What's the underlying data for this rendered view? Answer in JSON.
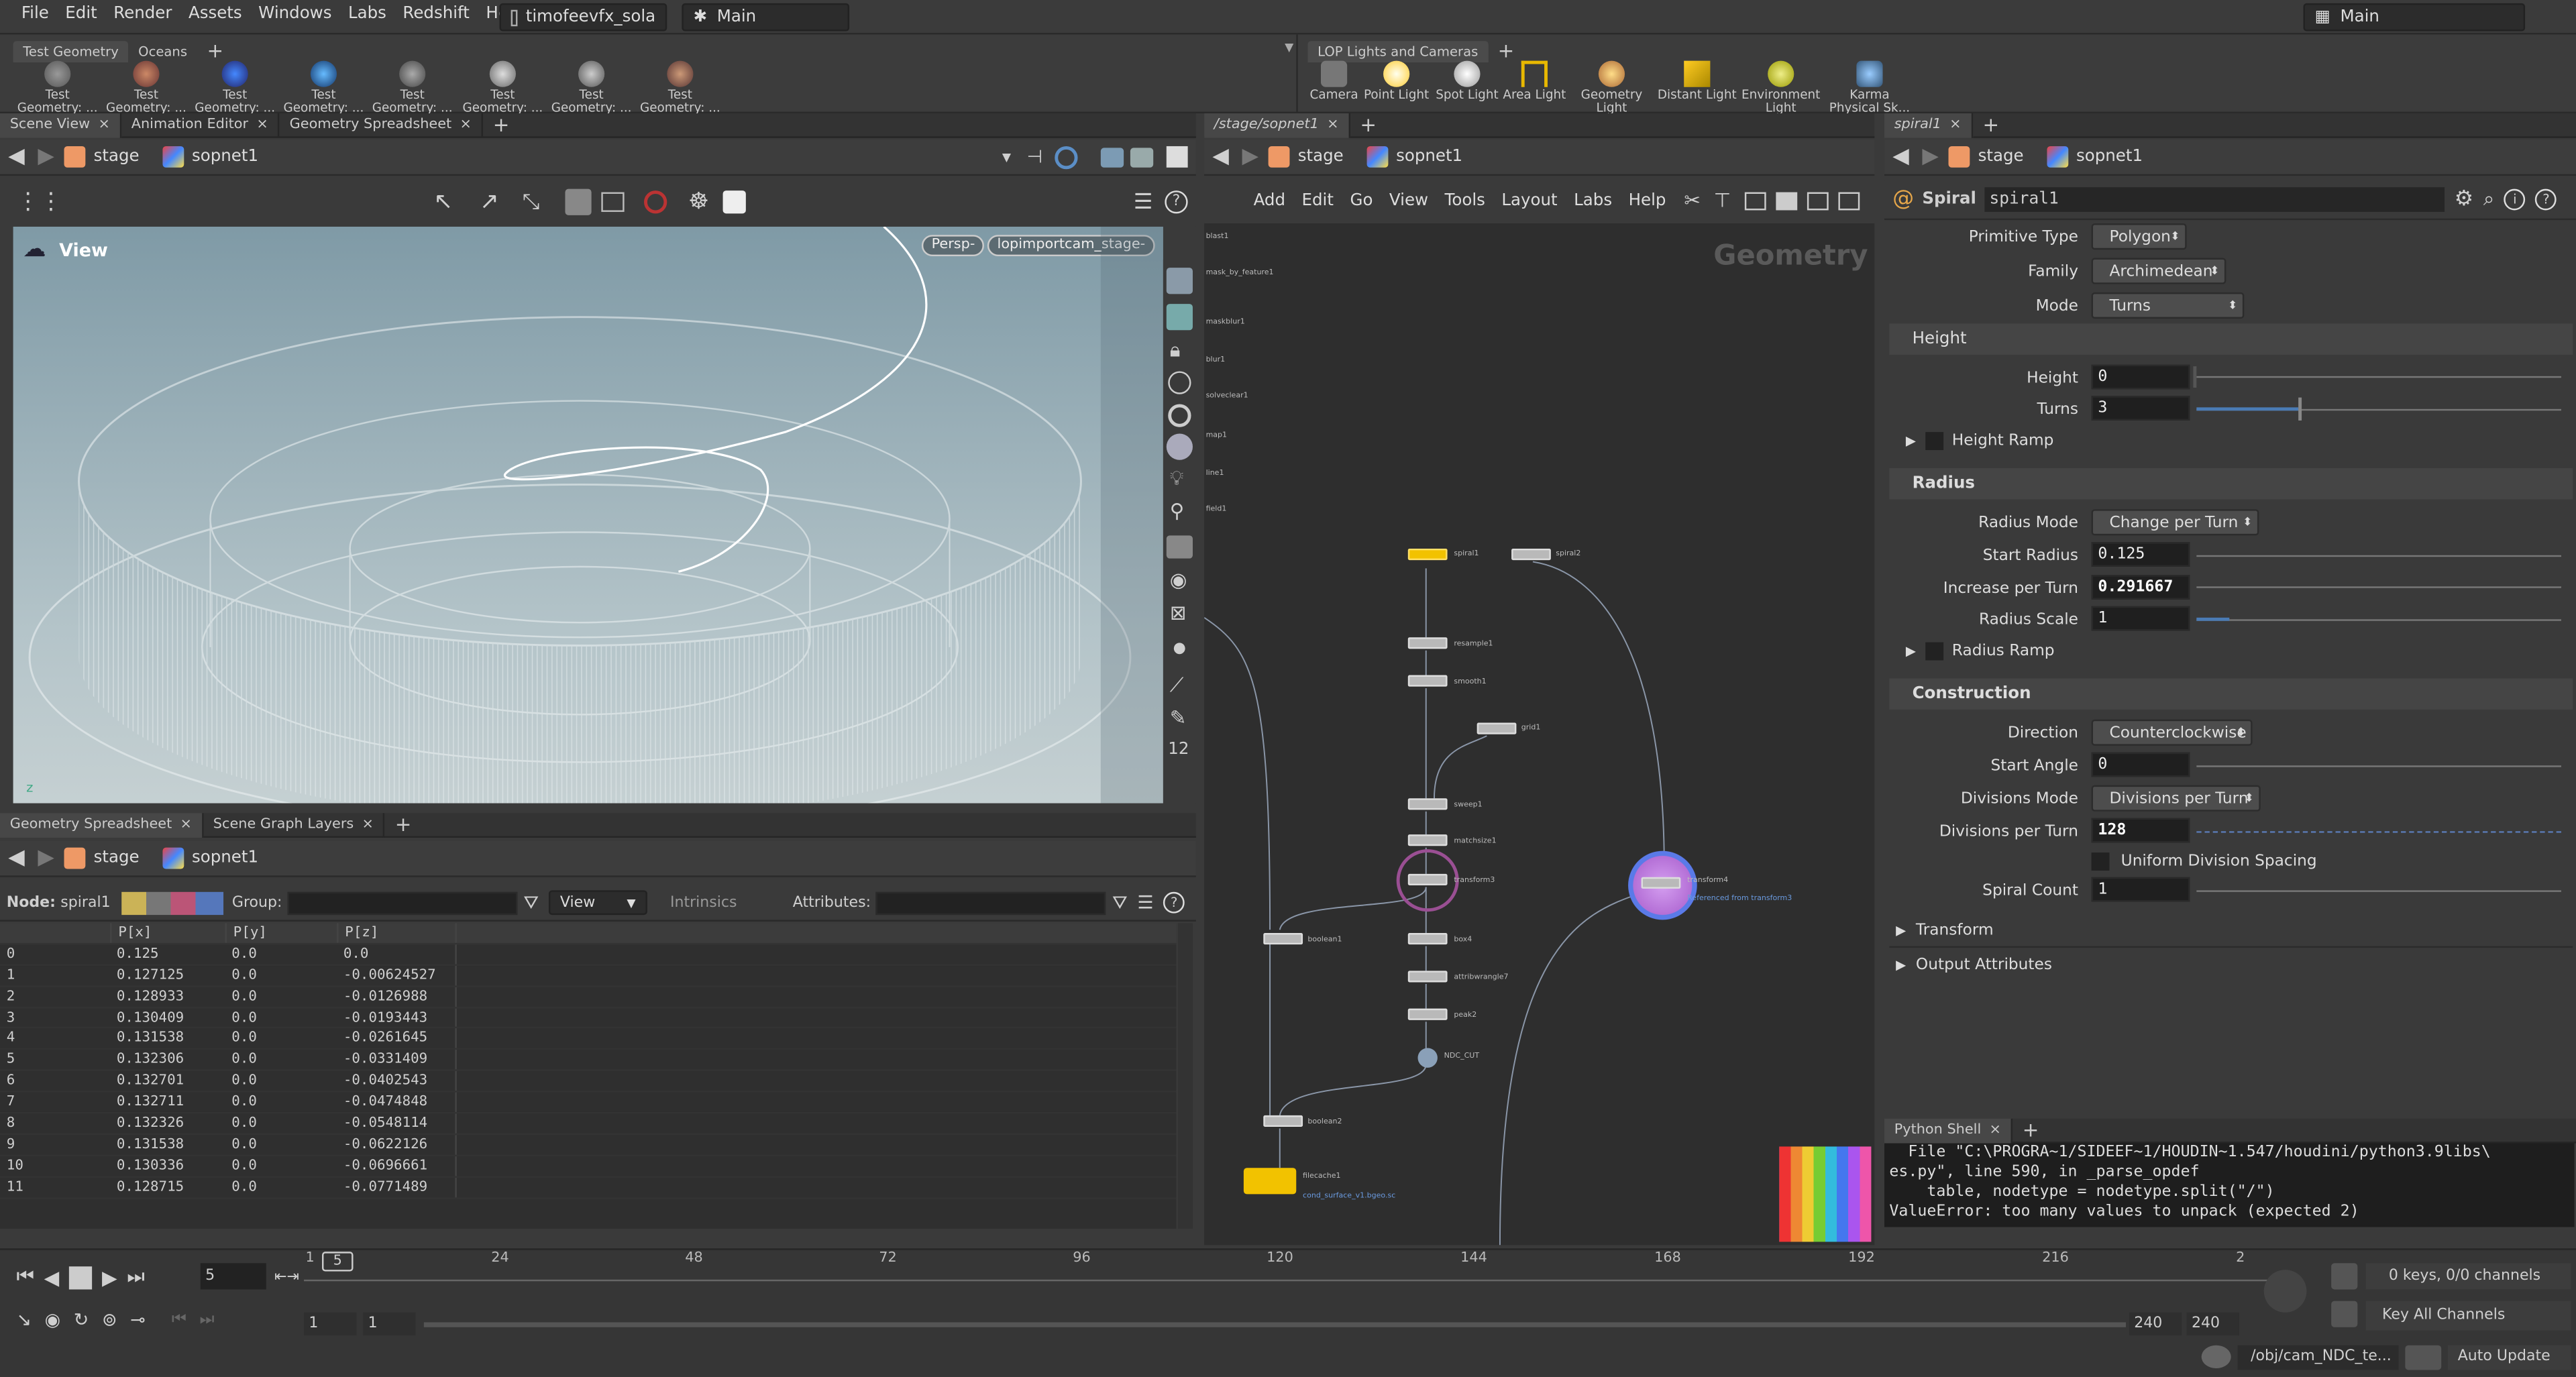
{
  "menubar": {
    "items": [
      "File",
      "Edit",
      "Render",
      "Assets",
      "Windows",
      "Labs",
      "Redshift",
      "Help"
    ],
    "file_combo": "timofeevfx_sola",
    "desktop_combo": "Main",
    "right_combo": "Main"
  },
  "shelf_left": {
    "tabs": [
      "Test Geometry",
      "Oceans"
    ],
    "tools": [
      "Test Geometry: ...",
      "Test Geometry: ...",
      "Test Geometry: ...",
      "Test Geometry: ...",
      "Test Geometry: ...",
      "Test Geometry: ...",
      "Test Geometry: ...",
      "Test Geometry: ..."
    ]
  },
  "shelf_right": {
    "tabs": [
      "LOP Lights and Cameras"
    ],
    "tools": [
      "Camera",
      "Point Light",
      "Spot Light",
      "Area Light",
      "Geometry Light",
      "Distant Light",
      "Environment Light",
      "Karma Physical Sk..."
    ]
  },
  "left_pane": {
    "tabs": [
      "Scene View",
      "Animation Editor",
      "Geometry Spreadsheet"
    ],
    "path": [
      "stage",
      "sopnet1"
    ],
    "view_label": "View",
    "persp": "Persp",
    "camera": "lopimportcam_stage",
    "side_number": "12"
  },
  "sheet": {
    "tabs": [
      "Geometry Spreadsheet",
      "Scene Graph Layers"
    ],
    "path": [
      "stage",
      "sopnet1"
    ],
    "node_label": "Node:",
    "node_value": "spiral1",
    "group_label": "Group:",
    "view_menu": "View",
    "intrinsics": "Intrinsics",
    "attributes_label": "Attributes:",
    "columns": [
      "P[x]",
      "P[y]",
      "P[z]"
    ],
    "rows": [
      [
        "0",
        "0.125",
        "0.0",
        "0.0"
      ],
      [
        "1",
        "0.127125",
        "0.0",
        "-0.00624527"
      ],
      [
        "2",
        "0.128933",
        "0.0",
        "-0.0126988"
      ],
      [
        "3",
        "0.130409",
        "0.0",
        "-0.0193443"
      ],
      [
        "4",
        "0.131538",
        "0.0",
        "-0.0261645"
      ],
      [
        "5",
        "0.132306",
        "0.0",
        "-0.0331409"
      ],
      [
        "6",
        "0.132701",
        "0.0",
        "-0.0402543"
      ],
      [
        "7",
        "0.132711",
        "0.0",
        "-0.0474848"
      ],
      [
        "8",
        "0.132326",
        "0.0",
        "-0.0548114"
      ],
      [
        "9",
        "0.131538",
        "0.0",
        "-0.0622126"
      ],
      [
        "10",
        "0.130336",
        "0.0",
        "-0.0696661"
      ],
      [
        "11",
        "0.128715",
        "0.0",
        "-0.0771489"
      ]
    ]
  },
  "network": {
    "tab": "/stage/sopnet1",
    "path": [
      "stage",
      "sopnet1"
    ],
    "menu": [
      "Add",
      "Edit",
      "Go",
      "View",
      "Tools",
      "Layout",
      "Labs",
      "Help"
    ],
    "watermark": "Geometry",
    "side_labels": [
      "blast1",
      "mask_by_feature1",
      "maskblur1",
      "blur1",
      "solveclear1",
      "map1",
      "line1",
      "field1"
    ],
    "nodes": [
      "spiral1",
      "spiral2",
      "resample1",
      "smooth1",
      "grid1",
      "sweep1",
      "matchsize1",
      "transform3",
      "transform4",
      "boolean1",
      "box4",
      "attribwrangle7",
      "peak2",
      "NDC_CUT",
      "boolean2",
      "filecache1"
    ],
    "transform4_note": "Referenced from transform3",
    "filecache_note": "cond_surface_v1.bgeo.sc"
  },
  "params": {
    "tab": "spiral1",
    "path": [
      "stage",
      "sopnet1"
    ],
    "node_type": "Spiral",
    "node_name": "spiral1",
    "primitive_type_label": "Primitive Type",
    "primitive_type": "Polygon",
    "family_label": "Family",
    "family": "Archimedean",
    "mode_label": "Mode",
    "mode": "Turns",
    "height_folder": "Height",
    "height_label": "Height",
    "height": "0",
    "turns_label": "Turns",
    "turns": "3",
    "turns_level": 0.28,
    "height_ramp": "Height Ramp",
    "radius_folder": "Radius",
    "radius_mode_label": "Radius Mode",
    "radius_mode": "Change per Turn",
    "start_radius_label": "Start Radius",
    "start_radius": "0.125",
    "increase_label": "Increase per Turn",
    "increase": "0.291667",
    "radius_scale_label": "Radius Scale",
    "radius_scale": "1",
    "radius_ramp": "Radius Ramp",
    "construction_folder": "Construction",
    "direction_label": "Direction",
    "direction": "Counterclockwise",
    "start_angle_label": "Start Angle",
    "start_angle": "0",
    "divisions_mode_label": "Divisions Mode",
    "divisions_mode": "Divisions per Turn",
    "divisions_per_turn_label": "Divisions per Turn",
    "divisions_per_turn": "128",
    "uniform_label": "Uniform Division Spacing",
    "spiral_count_label": "Spiral Count",
    "spiral_count": "1",
    "transform_folder": "Transform",
    "output_folder": "Output Attributes"
  },
  "python": {
    "tab": "Python Shell",
    "lines": [
      "  File \"C:\\PROGRA~1/SIDEEF~1/HOUDIN~1.547/houdini/python3.9libs\\",
      "es.py\", line 590, in _parse_opdef",
      "    table, nodetype = nodetype.split(\"/\")",
      "ValueError: too many values to unpack (expected 2)"
    ]
  },
  "timeline": {
    "current_frame": "5",
    "frame_marker": "5",
    "ticks": [
      "1",
      "24",
      "48",
      "72",
      "96",
      "120",
      "144",
      "168",
      "192",
      "216",
      "2"
    ],
    "start": "1",
    "start2": "1",
    "end": "240",
    "end2": "240",
    "keys": "0 keys, 0/0 channels",
    "key_all": "Key All Channels",
    "obj_path": "/obj/cam_NDC_te...",
    "auto_update": "Auto Update"
  },
  "colors": {
    "accent": "#f2c200",
    "selected_node": "#b46fd6",
    "bg": "#3a3a3a"
  }
}
